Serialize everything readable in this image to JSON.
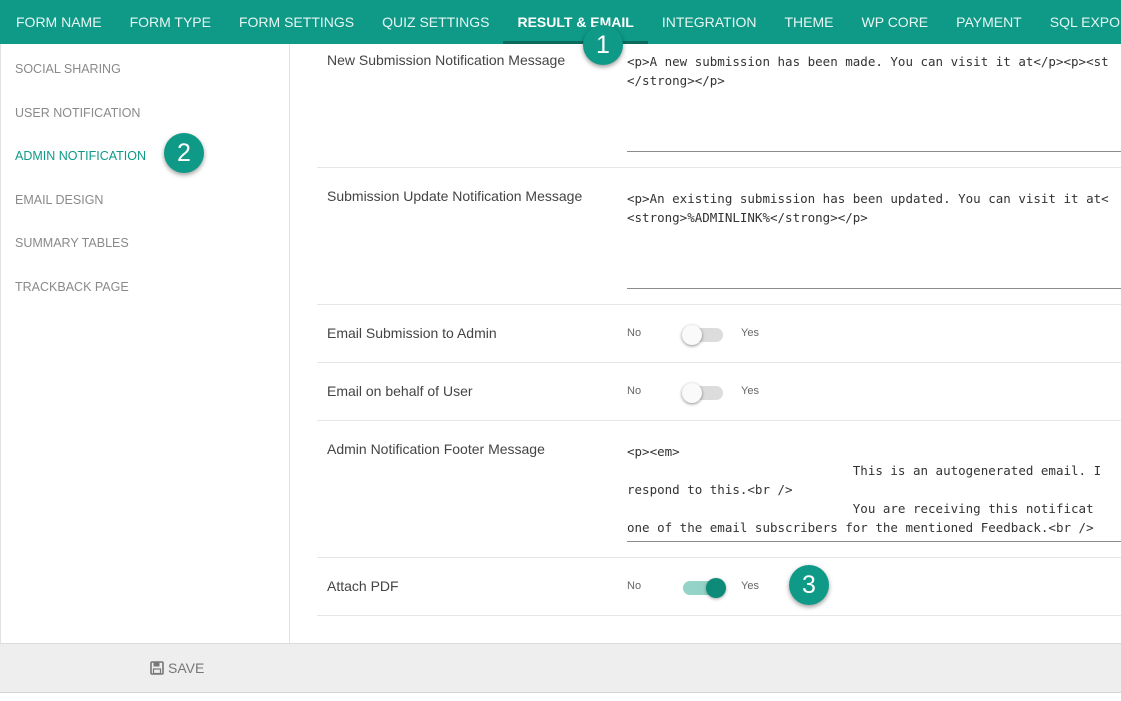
{
  "tabs": [
    "FORM NAME",
    "FORM TYPE",
    "FORM SETTINGS",
    "QUIZ SETTINGS",
    "RESULT & EMAIL",
    "INTEGRATION",
    "THEME",
    "WP CORE",
    "PAYMENT",
    "SQL EXPORT"
  ],
  "active_tab": "RESULT & EMAIL",
  "sidebar": {
    "items": [
      "SOCIAL SHARING",
      "USER NOTIFICATION",
      "ADMIN NOTIFICATION",
      "EMAIL DESIGN",
      "SUMMARY TABLES",
      "TRACKBACK PAGE"
    ],
    "active": "ADMIN NOTIFICATION"
  },
  "fields": {
    "new_submission": {
      "label": "New Submission Notification Message",
      "value": "<p>A new submission has been made. You can visit it at</p><p><st\n</strong></p>"
    },
    "update_submission": {
      "label": "Submission Update Notification Message",
      "value": "<p>An existing submission has been updated. You can visit it at<\n<strong>%ADMINLINK%</strong></p>"
    },
    "email_admin": {
      "label": "Email Submission to Admin",
      "no": "No",
      "yes": "Yes",
      "checked": false
    },
    "email_behalf": {
      "label": "Email on behalf of User",
      "no": "No",
      "yes": "Yes",
      "checked": false
    },
    "footer_message": {
      "label": "Admin Notification Footer Message",
      "value": "<p><em>\n                              This is an autogenerated email. I\nrespond to this.<br />\n                              You are receiving this notificat\none of the email subscribers for the mentioned Feedback.<br />"
    },
    "attach_pdf": {
      "label": "Attach PDF",
      "no": "No",
      "yes": "Yes",
      "checked": true
    }
  },
  "footer": {
    "save_label": "SAVE"
  },
  "badges": [
    "1",
    "2",
    "3"
  ],
  "colors": {
    "accent": "#0e9a87",
    "footer_bg": "#eeeeee"
  }
}
